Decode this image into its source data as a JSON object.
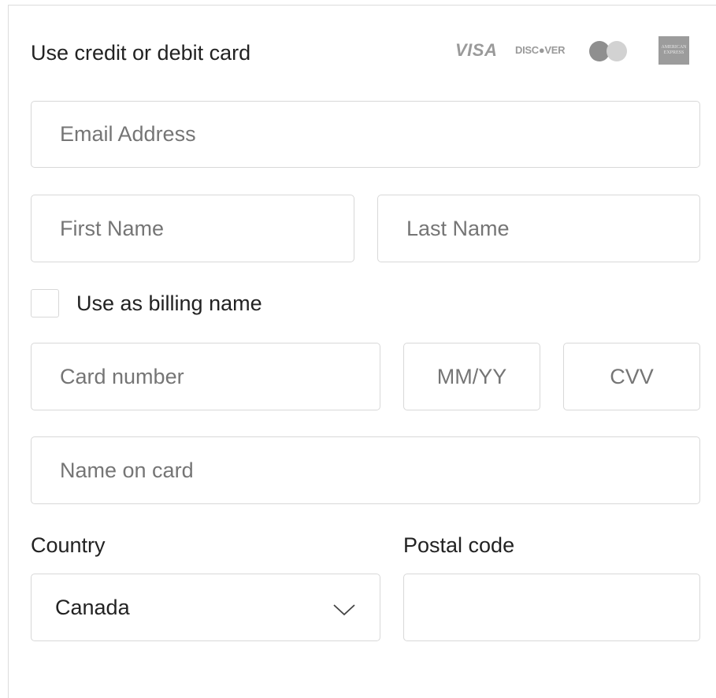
{
  "header": {
    "title": "Use credit or debit card",
    "card_brands": {
      "visa": "VISA",
      "discover": "DISC●VER",
      "mastercard_icon": "mastercard-icon",
      "amex_line1": "AMERICAN",
      "amex_line2": "EXPRESS"
    }
  },
  "fields": {
    "email_placeholder": "Email Address",
    "first_name_placeholder": "First Name",
    "last_name_placeholder": "Last Name",
    "card_number_placeholder": "Card number",
    "expiry_placeholder": "MM/YY",
    "cvv_placeholder": "CVV",
    "name_on_card_placeholder": "Name on card",
    "postal_code_value": ""
  },
  "billing": {
    "checkbox_label": "Use as billing name",
    "checked": false
  },
  "country": {
    "label": "Country",
    "selected": "Canada",
    "icon": "chevron-down-icon"
  },
  "postal": {
    "label": "Postal code"
  },
  "colors": {
    "border": "#d8d8d8",
    "placeholder": "#777777",
    "text": "#222222",
    "brand_gray": "#9a9a9a"
  }
}
